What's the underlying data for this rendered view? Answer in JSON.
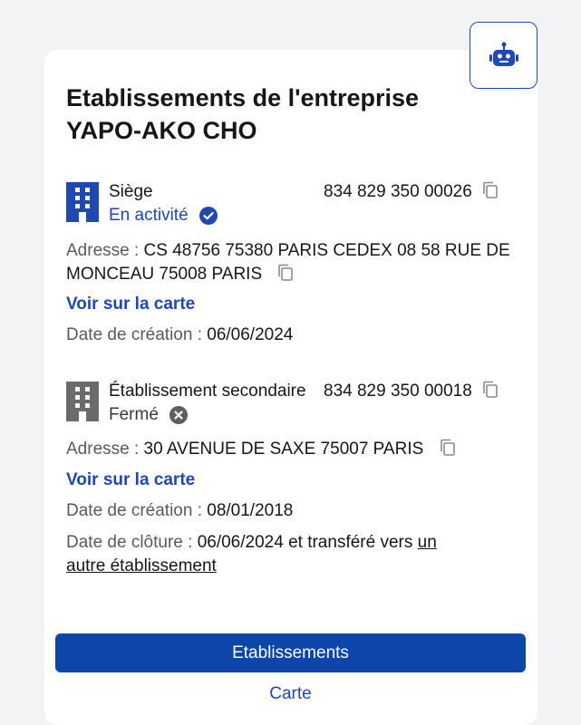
{
  "header": {
    "title_line1": "Etablissements de l'entreprise",
    "title_line2": "YAPO-AKO CHO",
    "assistant_icon": "robot-icon"
  },
  "etablissements": [
    {
      "type_label": "Siège",
      "status_label": "En activité",
      "status_icon": "check-circle-icon",
      "siret": "834 829 350 00026",
      "address_label": "Adresse : ",
      "address_value": "CS 48756 75380 PARIS CEDEX 08 58 RUE DE MONCEAU 75008 PARIS",
      "map_link": "Voir sur la carte",
      "creation_label": "Date de création : ",
      "creation_value": "06/06/2024"
    },
    {
      "type_label": "Établissement secondaire",
      "status_label": "Fermé",
      "status_icon": "x-circle-icon",
      "siret": "834 829 350 00018",
      "address_label": "Adresse : ",
      "address_value": "30 AVENUE DE SAXE 75007 PARIS",
      "map_link": "Voir sur la carte",
      "creation_label": "Date de création : ",
      "creation_value": "08/01/2018",
      "closure_label": "Date de clôture : ",
      "closure_value": "06/06/2024 et transféré vers ",
      "closure_link_part1": "un",
      "closure_link_part2": "autre établissement"
    }
  ],
  "actions": {
    "primary_label": "Etablissements",
    "secondary_label": "Carte"
  },
  "colors": {
    "accent": "#1f49b0",
    "primary_button": "#0b46a8",
    "closed_icon": "#6b6b6b"
  }
}
